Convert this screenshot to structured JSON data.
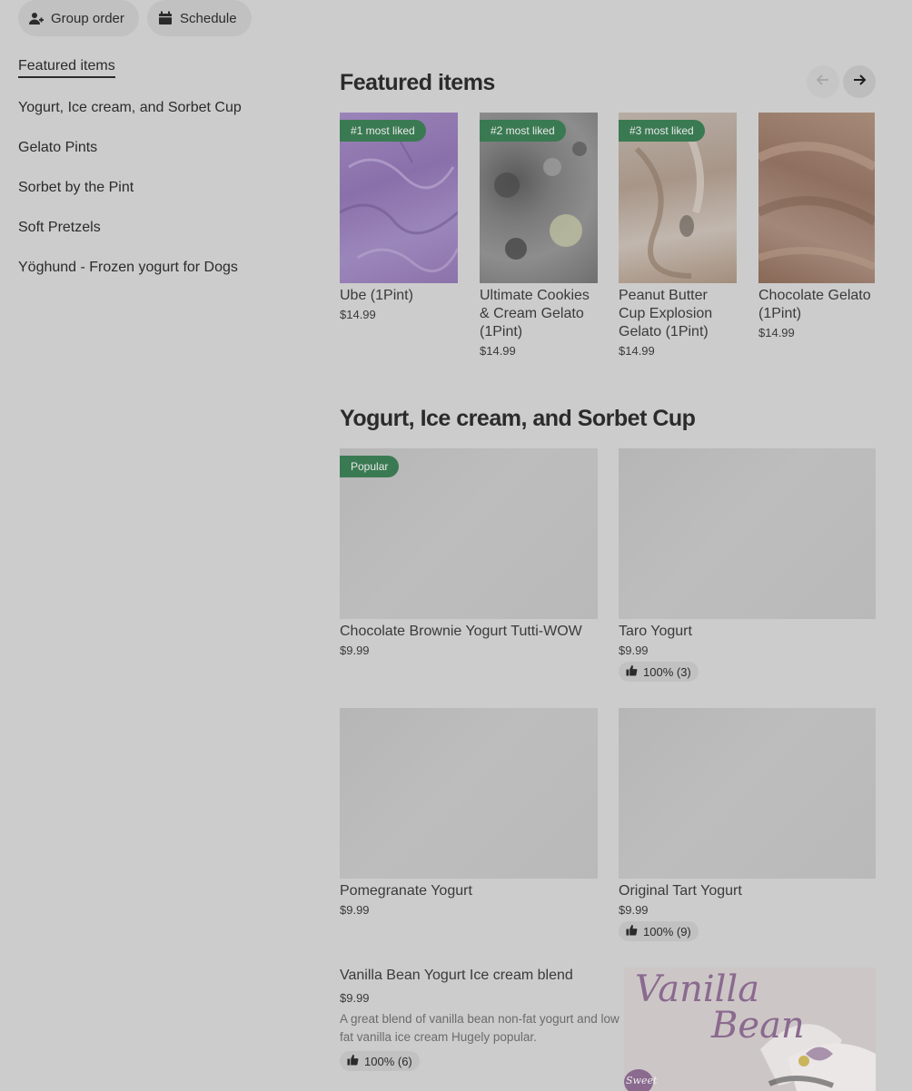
{
  "toolbar": {
    "group_order_label": "Group order",
    "schedule_label": "Schedule"
  },
  "sidebar": {
    "items": [
      {
        "label": "Featured items"
      },
      {
        "label": "Yogurt, Ice cream, and Sorbet Cup"
      },
      {
        "label": "Gelato Pints"
      },
      {
        "label": "Sorbet by the Pint"
      },
      {
        "label": "Soft Pretzels"
      },
      {
        "label": "Yöghund - Frozen yogurt for Dogs"
      }
    ]
  },
  "featured": {
    "title": "Featured items",
    "items": [
      {
        "badge": "#1 most liked",
        "name": "Ube (1Pint)",
        "price": "$14.99"
      },
      {
        "badge": "#2 most liked",
        "name": "Ultimate Cookies & Cream Gelato (1Pint)",
        "price": "$14.99"
      },
      {
        "badge": "#3 most liked",
        "name": "Peanut Butter Cup Explosion Gelato (1Pint)",
        "price": "$14.99"
      },
      {
        "badge": "",
        "name": "Chocolate Gelato (1Pint)",
        "price": "$14.99"
      }
    ]
  },
  "yogurt_section": {
    "title": "Yogurt, Ice cream, and Sorbet Cup",
    "items": [
      {
        "badge": "Popular",
        "name": "Chocolate Brownie Yogurt Tutti-WOW",
        "price": "$9.99",
        "rating": ""
      },
      {
        "badge": "",
        "name": "Taro Yogurt",
        "price": "$9.99",
        "rating": "100% (3)"
      },
      {
        "badge": "",
        "name": "Pomegranate Yogurt",
        "price": "$9.99",
        "rating": ""
      },
      {
        "badge": "",
        "name": "Original Tart Yogurt",
        "price": "$9.99",
        "rating": "100% (9)"
      }
    ],
    "vanilla": {
      "name": "Vanilla Bean Yogurt Ice cream blend",
      "price": "$9.99",
      "description": "A great blend of vanilla bean non-fat yogurt and low fat vanilla ice cream Hugely popular.",
      "rating": "100% (6)",
      "image_text_line1": "Vanilla",
      "image_text_line2": "Bean",
      "image_sticker": "Sweet"
    }
  },
  "colors": {
    "background": "#cccccc",
    "badge_green": "#3a7a52",
    "ube_purple": "#8f77ad"
  },
  "icons": {
    "group_order": "person-add-icon",
    "schedule": "calendar-icon",
    "prev": "arrow-left-icon",
    "next": "arrow-right-icon",
    "rating": "thumbs-up-icon"
  }
}
